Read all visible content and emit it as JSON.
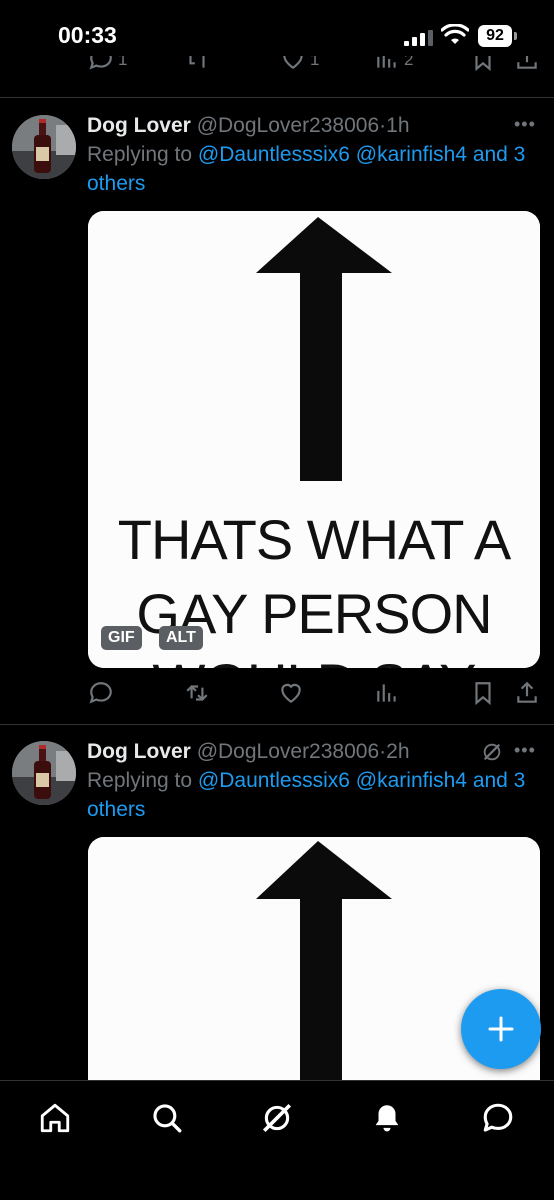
{
  "status_bar": {
    "time": "00:33",
    "battery": "92"
  },
  "prev_tweet_counts": {
    "replies": "1",
    "retweets": "",
    "likes": "1",
    "views": "2"
  },
  "tweets": [
    {
      "name": "Dog Lover",
      "handle": "@DogLover238006",
      "dot": "·",
      "time": "1h",
      "replying_to_prefix": "Replying to",
      "mentions": "@Dauntlesssix6 @karinfish4 and 3",
      "mentions_cont": "others",
      "image_text_line1": "THATS WHAT A",
      "image_text_line2": "GAY PERSON",
      "image_text_line3": "WOULD SAY",
      "badge_gif": "GIF",
      "badge_alt": "ALT"
    },
    {
      "name": "Dog Lover",
      "handle": "@DogLover238006",
      "dot": "·",
      "time": "2h",
      "replying_to_prefix": "Replying to",
      "mentions": "@Dauntlesssix6 @karinfish4 and 3",
      "mentions_cont": "others"
    }
  ],
  "icons": {
    "tabs": [
      "home-icon",
      "search-icon",
      "grok-icon",
      "notifications-icon",
      "messages-icon"
    ],
    "actions": [
      "reply-icon",
      "retweet-icon",
      "like-icon",
      "views-icon",
      "bookmark-icon",
      "share-icon"
    ]
  },
  "colors": {
    "accent": "#1d9bf0",
    "background": "#000000",
    "muted": "#71767b",
    "text": "#e7e9ea"
  }
}
